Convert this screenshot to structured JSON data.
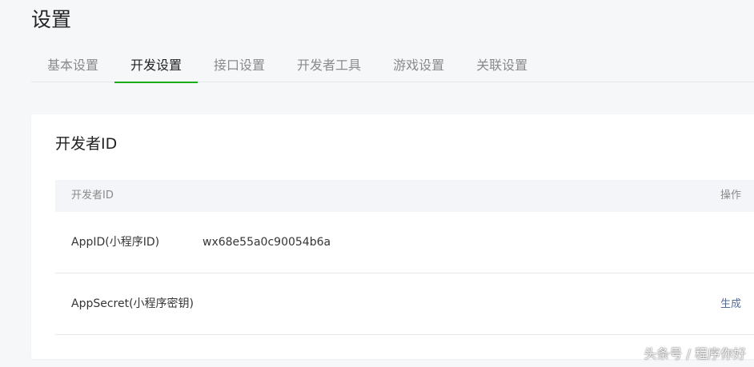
{
  "page": {
    "title": "设置"
  },
  "tabs": [
    {
      "label": "基本设置"
    },
    {
      "label": "开发设置"
    },
    {
      "label": "接口设置"
    },
    {
      "label": "开发者工具"
    },
    {
      "label": "游戏设置"
    },
    {
      "label": "关联设置"
    }
  ],
  "active_tab_index": 1,
  "developer_id_card": {
    "title": "开发者ID",
    "table": {
      "columns": {
        "id": "开发者ID",
        "action": "操作"
      },
      "rows": [
        {
          "label": "AppID(小程序ID)",
          "value": "wx68e55a0c90054b6a",
          "action": ""
        },
        {
          "label": "AppSecret(小程序密钥)",
          "value": "",
          "action": "生成"
        }
      ]
    }
  },
  "watermark": "头条号 / 程序你好",
  "colors": {
    "accent": "#1aad19",
    "link": "#576b95",
    "background": "#f6f7f9"
  }
}
